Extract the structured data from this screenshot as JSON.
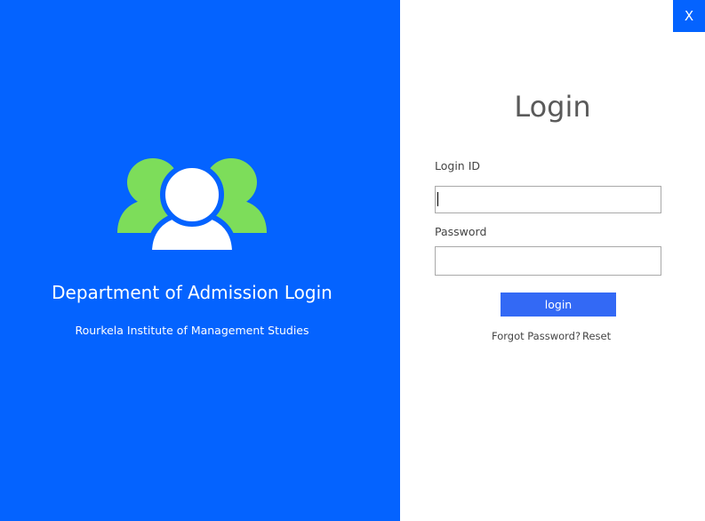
{
  "left_panel": {
    "background_color": "#0463ff",
    "illustration_icon": "users-group-icon",
    "illustration_colors": {
      "front": "#ffffff",
      "back": "#7ddd5a"
    },
    "title": "Department of Admission Login",
    "subtitle": "Rourkela Institute of Management Studies"
  },
  "window": {
    "close_label": "X"
  },
  "login_form": {
    "heading": "Login",
    "login_id_label": "Login ID",
    "login_id_value": "",
    "password_label": "Password",
    "password_value": "",
    "submit_label": "login",
    "submit_color": "#3369f5",
    "forgot_password_label": "Forgot Password?",
    "reset_label": "Reset"
  }
}
